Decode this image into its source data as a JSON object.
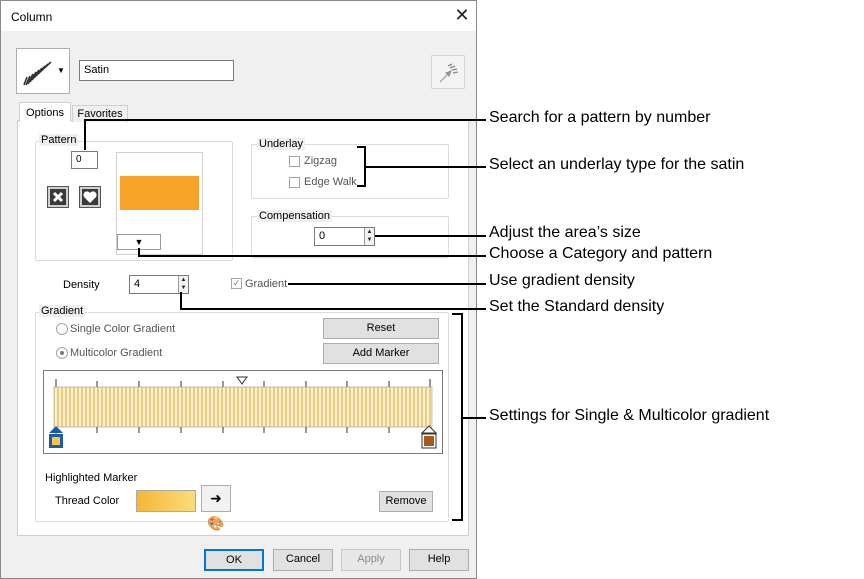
{
  "window": {
    "title": "Column"
  },
  "top": {
    "stitch_type_value": "Satin"
  },
  "tabs": [
    {
      "label": "Options"
    },
    {
      "label": "Favorites"
    }
  ],
  "pattern": {
    "label": "Pattern",
    "number_value": "0",
    "swatch_color": "#f7a42a"
  },
  "underlay": {
    "label": "Underlay",
    "zigzag": "Zigzag",
    "edge_walk": "Edge Walk"
  },
  "compensation": {
    "label": "Compensation",
    "value": "0"
  },
  "density": {
    "label": "Density",
    "value": "4",
    "gradient_checkbox": "Gradient"
  },
  "gradient": {
    "label": "Gradient",
    "single_color": "Single Color Gradient",
    "multicolor": "Multicolor Gradient",
    "reset": "Reset",
    "add_marker": "Add Marker",
    "start_color": "#f5c842",
    "end_color": "#a65a1e"
  },
  "highlighted_marker": {
    "label": "Highlighted Marker",
    "thread_color_label": "Thread Color",
    "remove": "Remove"
  },
  "footer": {
    "ok": "OK",
    "cancel": "Cancel",
    "apply": "Apply",
    "help": "Help"
  },
  "callouts": {
    "c1": "Search for a pattern by number",
    "c2": "Select an underlay type for the satin",
    "c3": "Adjust the area’s size",
    "c4": "Choose a Category and pattern",
    "c5": "Use gradient density",
    "c6": "Set the Standard density",
    "c7": "Settings for Single & Multicolor gradient"
  }
}
